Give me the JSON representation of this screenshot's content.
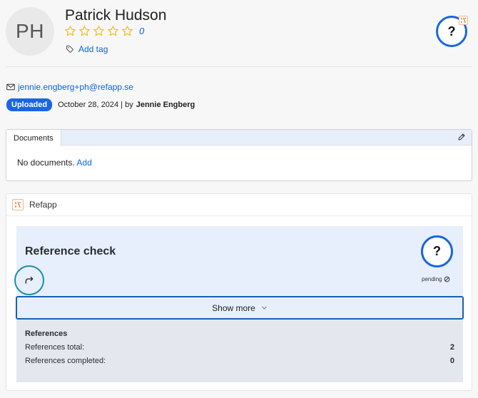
{
  "profile": {
    "initials": "PH",
    "name": "Patrick Hudson",
    "rating_count": "0",
    "add_tag_label": "Add tag",
    "help_label": "?"
  },
  "contact": {
    "email": "jennie.engberg+ph@refapp.se",
    "status": "Uploaded",
    "date_text": "October 28, 2024 | by",
    "author": "Jennie Engberg"
  },
  "documents": {
    "tab_label": "Documents",
    "empty_text": "No documents.",
    "add_label": "Add"
  },
  "refapp": {
    "title": "Refapp",
    "check_title": "Reference check",
    "help_label": "?",
    "status_text": "pending",
    "show_more_label": "Show more",
    "references_title": "References",
    "rows": [
      {
        "label": "References total:",
        "value": "2"
      },
      {
        "label": "References completed:",
        "value": "0"
      }
    ]
  },
  "colors": {
    "accent": "#1a66e0",
    "link": "#0b66d6",
    "star": "#f0c419",
    "logo": "#f07a2c"
  }
}
